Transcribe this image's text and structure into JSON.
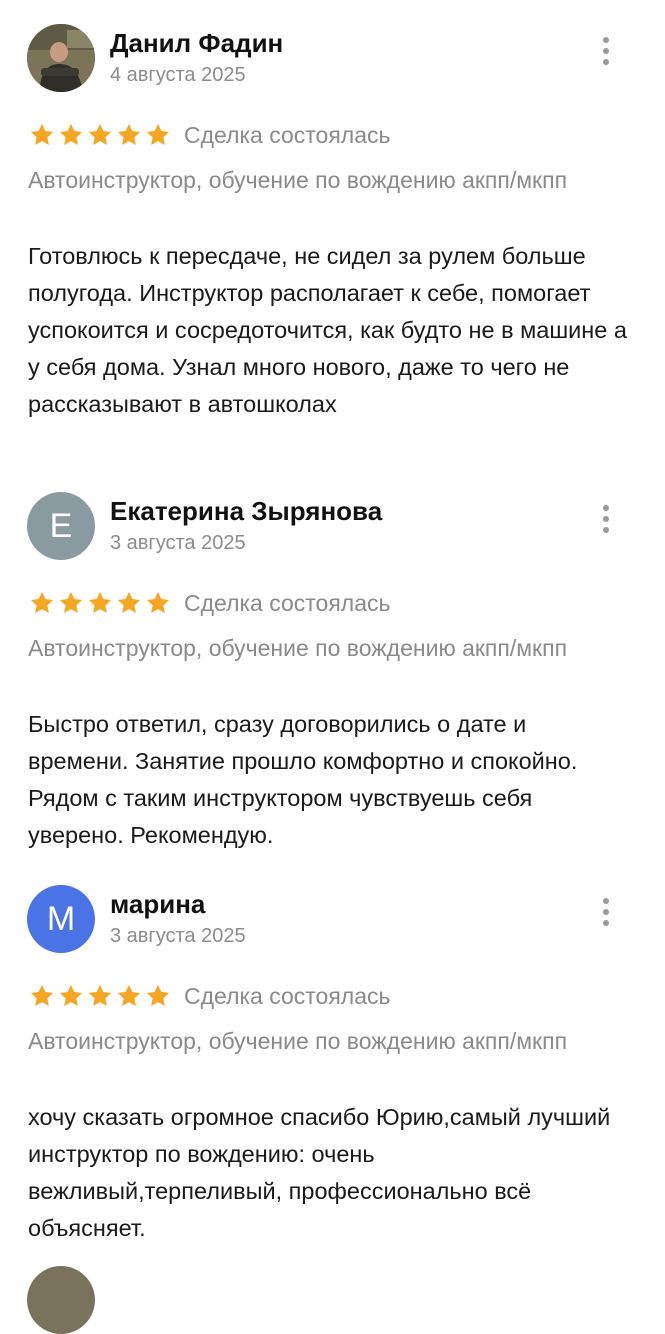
{
  "reviews": [
    {
      "name": "Данил Фадин",
      "date": "4 августа 2025",
      "avatar_letter": "",
      "avatar_color": "#6d6a4c",
      "rating": 5,
      "status": "Сделка состоялась",
      "service": "Автоинструктор, обучение по вождению акпп/мкпп",
      "text": "Готовлюсь к пересдаче, не сидел за рулем больше полугода. Инструктор располагает к себе, помогает успокоится и сосредоточится, как будто не в машине а у себя дома. Узнал много нового, даже то чего не рассказывают в автошколах"
    },
    {
      "name": "Екатерина Зырянова",
      "date": "3 августа 2025",
      "avatar_letter": "Е",
      "avatar_color": "#8a9aa1",
      "rating": 5,
      "status": "Сделка состоялась",
      "service": "Автоинструктор, обучение по вождению акпп/мкпп",
      "text": "Быстро ответил, сразу договорились о дате и времени. Занятие прошло комфортно и спокойно. Рядом с таким инструктором чувствуешь себя уверено. Рекомендую."
    },
    {
      "name": "марина",
      "date": "3 августа 2025",
      "avatar_letter": "М",
      "avatar_color": "#4a73e6",
      "rating": 5,
      "status": "Сделка состоялась",
      "service": "Автоинструктор, обучение по вождению акпп/мкпп",
      "text": "хочу сказать огромное спасибо Юрию,самый лучший инструктор  по вождению: очень вежливый,терпеливый, профессионально всё объясняет."
    }
  ],
  "colors": {
    "star": "#f5a623",
    "muted_text": "#8a8a8a",
    "body_text": "#1a1a1a"
  },
  "icons": {
    "star": "star-icon",
    "menu": "more-vertical-icon"
  }
}
